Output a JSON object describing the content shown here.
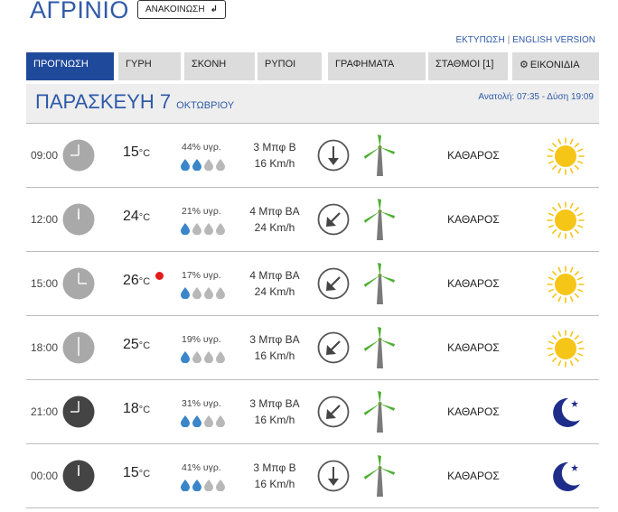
{
  "header": {
    "city": "ΑΓΡΙΝΙΟ",
    "announce_label": "ΑΝΑΚΟΙΝΩΣΗ",
    "print_link": "ΕΚΤΥΠΩΣΗ",
    "english_link": "ENGLISH VERSION"
  },
  "tabs": [
    {
      "label": "ΠΡΟΓΝΩΣΗ",
      "active": true
    },
    {
      "label": "ΓΥΡΗ"
    },
    {
      "label": "ΣΚΟΝΗ"
    },
    {
      "label": "ΡΥΠΟΙ"
    },
    {
      "label": "ΓΡΑΦΗΜΑΤΑ"
    },
    {
      "label": "ΣΤΑΘΜΟΙ [1]"
    },
    {
      "label": "ΕΙΚΟΝΙΔΙΑ"
    }
  ],
  "day": {
    "name": "ΠΑΡΑΣΚΕΥΗ 7",
    "month": "ΟΚΤΩΒΡΙΟΥ",
    "sun": "Ανατολή: 07:35  - Δύση 19:09"
  },
  "temp_unit": "°C",
  "colors": {
    "accent": "#2f5aa8",
    "tab_active": "#1f4a9c",
    "tab": "#dcdcdc",
    "sun": "#f5c518",
    "moon": "#1f2d8a",
    "drop_full": "#3a86c8",
    "drop_empty": "#b8b8b8",
    "clock_day": "#a9a9a9",
    "clock_night": "#444444",
    "max_dot": "#e41b1b"
  },
  "rows": [
    {
      "time": "09:00",
      "hour": 9,
      "night": false,
      "temp": "15",
      "max": false,
      "humidity": "44% υγρ.",
      "drops": 2,
      "wind_bf": "3 Μπφ Β",
      "wind_kmh": "16 Km/h",
      "dir_icon": "arrow-down-icon",
      "sky": "ΚΑΘΑΡΟΣ",
      "icon": "sun-icon"
    },
    {
      "time": "12:00",
      "hour": 12,
      "night": false,
      "temp": "24",
      "max": false,
      "humidity": "21% υγρ.",
      "drops": 1,
      "wind_bf": "4 Μπφ ΒΑ",
      "wind_kmh": "24 Km/h",
      "dir_icon": "arrow-down-left-icon",
      "sky": "ΚΑΘΑΡΟΣ",
      "icon": "sun-icon"
    },
    {
      "time": "15:00",
      "hour": 15,
      "night": false,
      "temp": "26",
      "max": true,
      "humidity": "17% υγρ.",
      "drops": 1,
      "wind_bf": "4 Μπφ ΒΑ",
      "wind_kmh": "24 Km/h",
      "dir_icon": "arrow-down-left-icon",
      "sky": "ΚΑΘΑΡΟΣ",
      "icon": "sun-icon"
    },
    {
      "time": "18:00",
      "hour": 18,
      "night": false,
      "temp": "25",
      "max": false,
      "humidity": "19% υγρ.",
      "drops": 1,
      "wind_bf": "3 Μπφ ΒΑ",
      "wind_kmh": "16 Km/h",
      "dir_icon": "arrow-down-left-icon",
      "sky": "ΚΑΘΑΡΟΣ",
      "icon": "sun-icon"
    },
    {
      "time": "21:00",
      "hour": 21,
      "night": true,
      "temp": "18",
      "max": false,
      "humidity": "31% υγρ.",
      "drops": 2,
      "wind_bf": "3 Μπφ ΒΑ",
      "wind_kmh": "16 Km/h",
      "dir_icon": "arrow-down-left-icon",
      "sky": "ΚΑΘΑΡΟΣ",
      "icon": "moon-icon"
    },
    {
      "time": "00:00",
      "hour": 0,
      "night": true,
      "temp": "15",
      "max": false,
      "humidity": "41% υγρ.",
      "drops": 2,
      "wind_bf": "3 Μπφ Β",
      "wind_kmh": "16 Km/h",
      "dir_icon": "arrow-down-icon",
      "sky": "ΚΑΘΑΡΟΣ",
      "icon": "moon-icon"
    }
  ]
}
